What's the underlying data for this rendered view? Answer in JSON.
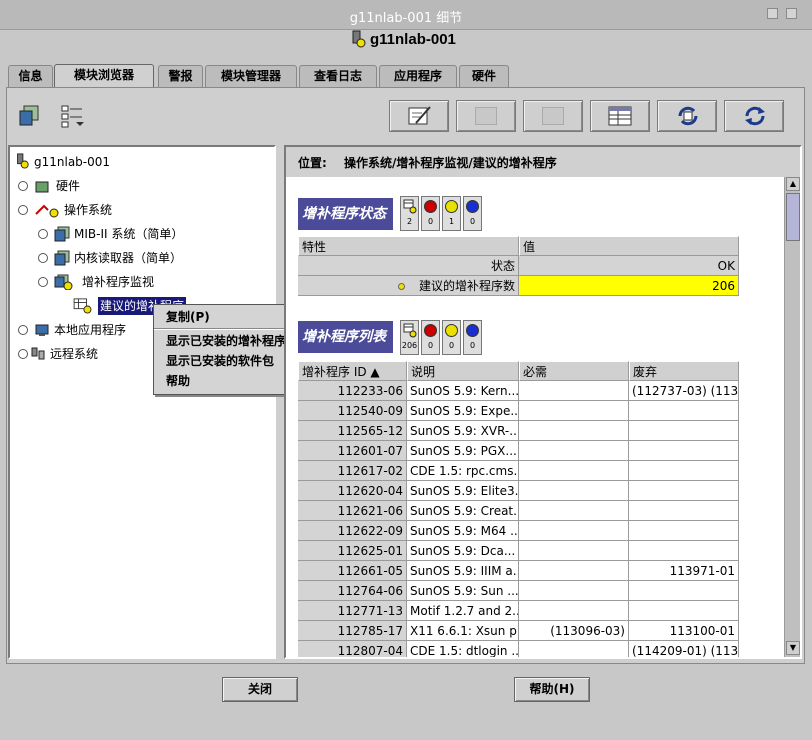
{
  "window": {
    "title": "g11nlab-001 细节",
    "host": "g11nlab-001"
  },
  "tabs": [
    {
      "label": "信息"
    },
    {
      "label": "模块浏览器"
    },
    {
      "label": "警报"
    },
    {
      "label": "模块管理器"
    },
    {
      "label": "查看日志"
    },
    {
      "label": "应用程序"
    },
    {
      "label": "硬件"
    }
  ],
  "active_tab": "模块浏览器",
  "toolbar": {
    "icons": [
      "edit-icon",
      "graph-disabled-icon",
      "chart-disabled-icon",
      "table-icon",
      "probe-icon",
      "refresh-icon"
    ]
  },
  "tree": {
    "root": "g11nlab-001",
    "items": [
      {
        "label": "硬件"
      },
      {
        "label": "操作系统"
      },
      {
        "label": "MIB-II 系统（简单）"
      },
      {
        "label": "内核读取器（简单）"
      },
      {
        "label": "增补程序监视"
      },
      {
        "label": "建议的增补程序"
      },
      {
        "label": "本地应用程序"
      },
      {
        "label": "远程系统"
      }
    ]
  },
  "context_menu": {
    "items": [
      {
        "label": "复制(P)"
      },
      {
        "label": "显示已安装的增补程序"
      },
      {
        "label": "显示已安装的软件包"
      },
      {
        "label": "帮助"
      }
    ]
  },
  "location": {
    "label": "位置:",
    "path": "操作系统/增补程序监视/建议的增补程序"
  },
  "status_section": {
    "title": "增补程序状态",
    "badges": [
      {
        "icon": "table-icon",
        "count": "2"
      },
      {
        "icon": "critical-icon",
        "count": "0",
        "color": "#cc0000"
      },
      {
        "icon": "warning-icon",
        "count": "1",
        "color": "#e8e000"
      },
      {
        "icon": "info-icon",
        "count": "0",
        "color": "#1a2fcf"
      }
    ],
    "headers": [
      "特性",
      "值"
    ],
    "rows": [
      {
        "property": "状态",
        "value": "OK"
      },
      {
        "property": "建议的增补程序数",
        "value": "206",
        "highlight": "#ffff00"
      }
    ]
  },
  "list_section": {
    "title": "增补程序列表",
    "badges": [
      {
        "icon": "table-icon",
        "count": "206"
      },
      {
        "icon": "critical-icon",
        "count": "0",
        "color": "#cc0000"
      },
      {
        "icon": "warning-icon",
        "count": "0",
        "color": "#e8e000"
      },
      {
        "icon": "info-icon",
        "count": "0",
        "color": "#1a2fcf"
      }
    ],
    "headers": [
      "增补程序 ID ▲",
      "说明",
      "必需",
      "废弃"
    ],
    "rows": [
      [
        "112233-06",
        "SunOS 5.9: Kern...",
        "",
        "(112737-03) (113..."
      ],
      [
        "112540-09",
        "SunOS 5.9: Expe...",
        "",
        ""
      ],
      [
        "112565-12",
        "SunOS 5.9: XVR-...",
        "",
        ""
      ],
      [
        "112601-07",
        "SunOS 5.9: PGX...",
        "",
        ""
      ],
      [
        "112617-02",
        "CDE 1.5: rpc.cms...",
        "",
        ""
      ],
      [
        "112620-04",
        "SunOS 5.9: Elite3...",
        "",
        ""
      ],
      [
        "112621-06",
        "SunOS 5.9: Creat...",
        "",
        ""
      ],
      [
        "112622-09",
        "SunOS 5.9: M64 ...",
        "",
        ""
      ],
      [
        "112625-01",
        "SunOS 5.9: Dca...",
        "",
        ""
      ],
      [
        "112661-05",
        "SunOS 5.9: IIIM a...",
        "",
        "113971-01"
      ],
      [
        "112764-06",
        "SunOS 5.9: Sun ...",
        "",
        ""
      ],
      [
        "112771-13",
        "Motif 1.2.7 and 2...",
        "",
        ""
      ],
      [
        "112785-17",
        "X11 6.6.1: Xsun p...",
        "(113096-03)",
        "113100-01"
      ],
      [
        "112807-04",
        "CDE 1.5: dtlogin ...",
        "",
        "(114209-01) (113..."
      ]
    ]
  },
  "buttons": {
    "close": "关闭",
    "help": "帮助(H)"
  }
}
